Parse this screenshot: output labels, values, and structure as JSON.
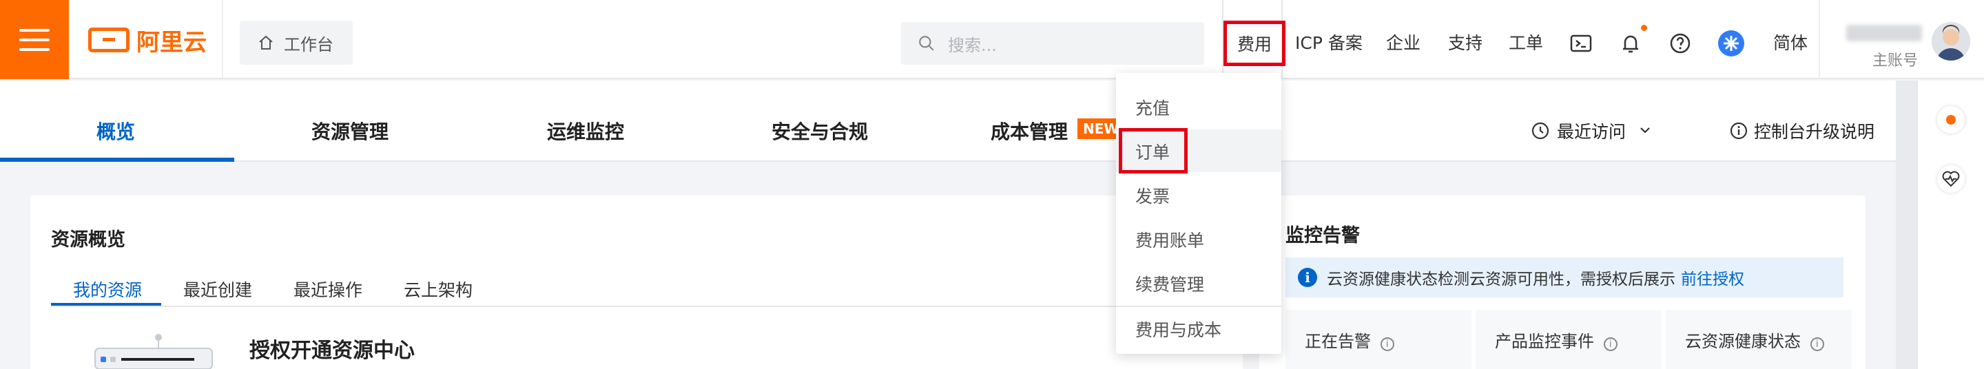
{
  "brand": {
    "logo_text": "阿里云",
    "accent": "#ff6a00",
    "primary": "#0064c8",
    "highlight": "#e60012"
  },
  "header": {
    "workbench_label": "工作台",
    "search_placeholder": "搜索...",
    "nav": {
      "fee": "费用",
      "icp": "ICP 备案",
      "enterprise": "企业",
      "support": "支持",
      "ticket": "工单",
      "language": "简体"
    },
    "icons": [
      "menu-icon",
      "home-icon",
      "search-icon",
      "terminal-icon",
      "bell-icon",
      "help-icon",
      "app-switch-icon"
    ],
    "account_sub": "主账号"
  },
  "tabs": {
    "overview": "概览",
    "resource": "资源管理",
    "ops": "运维监控",
    "security": "安全与合规",
    "cost": "成本管理",
    "new_badge": "NEW",
    "recent": "最近访问",
    "upgrade": "控制台升级说明"
  },
  "resource_card": {
    "title": "资源概览",
    "subtabs": [
      "我的资源",
      "最近创建",
      "最近操作",
      "云上架构"
    ],
    "authorize_title": "授权开通资源中心"
  },
  "monitor_card": {
    "title": "监控告警",
    "notice": "云资源健康状态检测云资源可用性，需授权后展示",
    "notice_link": "前往授权",
    "stats": [
      "正在告警",
      "产品监控事件",
      "云资源健康状态"
    ]
  },
  "fee_dropdown": {
    "items": [
      "充值",
      "订单",
      "发票",
      "费用账单",
      "续费管理",
      "费用与成本"
    ],
    "selected": "订单"
  }
}
